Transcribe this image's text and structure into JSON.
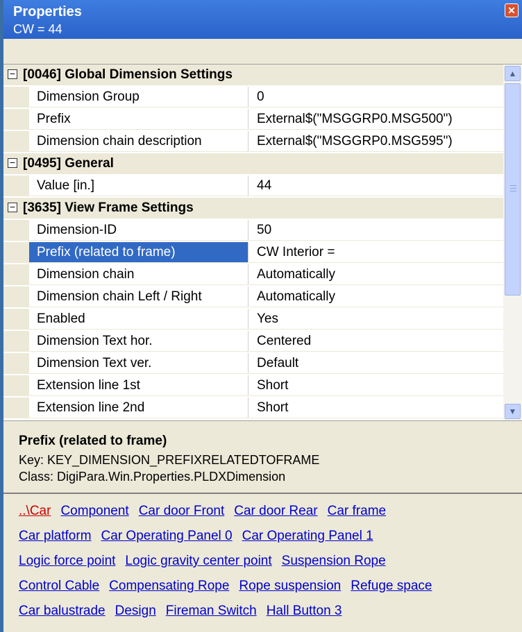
{
  "window": {
    "title": "Properties",
    "subtitle": "CW = 44"
  },
  "grid": {
    "rows": [
      {
        "type": "category",
        "label": "[0046] Global Dimension Settings"
      },
      {
        "type": "property",
        "name": "Dimension Group",
        "value": "0"
      },
      {
        "type": "property",
        "name": "Prefix",
        "value": "External$(\"MSGGRP0.MSG500\")"
      },
      {
        "type": "property",
        "name": "Dimension chain description",
        "value": "External$(\"MSGGRP0.MSG595\")"
      },
      {
        "type": "category",
        "label": "[0495] General"
      },
      {
        "type": "property",
        "name": "Value [in.]",
        "value": "44"
      },
      {
        "type": "category",
        "label": "[3635] View Frame Settings"
      },
      {
        "type": "property",
        "name": "Dimension-ID",
        "value": "50"
      },
      {
        "type": "property",
        "name": "Prefix (related to frame)",
        "value": "CW Interior =",
        "selected": true
      },
      {
        "type": "property",
        "name": "Dimension chain",
        "value": "Automatically"
      },
      {
        "type": "property",
        "name": "Dimension chain Left / Right",
        "value": "Automatically"
      },
      {
        "type": "property",
        "name": "Enabled",
        "value": "Yes"
      },
      {
        "type": "property",
        "name": "Dimension Text hor.",
        "value": "Centered"
      },
      {
        "type": "property",
        "name": "Dimension Text ver.",
        "value": "Default"
      },
      {
        "type": "property",
        "name": "Extension line 1st",
        "value": "Short"
      },
      {
        "type": "property",
        "name": "Extension line 2nd",
        "value": "Short"
      }
    ]
  },
  "help": {
    "title": "Prefix (related to frame)",
    "key": "Key:  KEY_DIMENSION_PREFIXRELATEDTOFRAME",
    "class": "Class:  DigiPara.Win.Properties.PLDXDimension"
  },
  "links": [
    [
      {
        "label": "..\\Car",
        "current": true
      },
      {
        "label": "Component"
      },
      {
        "label": "Car door Front"
      },
      {
        "label": "Car door Rear"
      },
      {
        "label": "Car frame"
      }
    ],
    [
      {
        "label": "Car platform"
      },
      {
        "label": "Car Operating Panel 0"
      },
      {
        "label": "Car Operating Panel 1"
      }
    ],
    [
      {
        "label": "Logic force point"
      },
      {
        "label": "Logic gravity center point"
      },
      {
        "label": "Suspension Rope"
      }
    ],
    [
      {
        "label": "Control Cable"
      },
      {
        "label": "Compensating Rope"
      },
      {
        "label": "Rope suspension"
      },
      {
        "label": "Refuge space"
      }
    ],
    [
      {
        "label": "Car balustrade"
      },
      {
        "label": "Design"
      },
      {
        "label": "Fireman Switch"
      },
      {
        "label": "Hall Button 3"
      }
    ]
  ],
  "icons": {
    "close": "close-icon",
    "collapse": "minus-box-icon",
    "scroll_up": "chevron-up-icon",
    "scroll_down": "chevron-down-icon"
  },
  "colors": {
    "titlebar": "#2a62c9",
    "selection": "#316ac5",
    "link": "#0000cc",
    "current_link": "#cc0000",
    "close": "#d9502e"
  }
}
